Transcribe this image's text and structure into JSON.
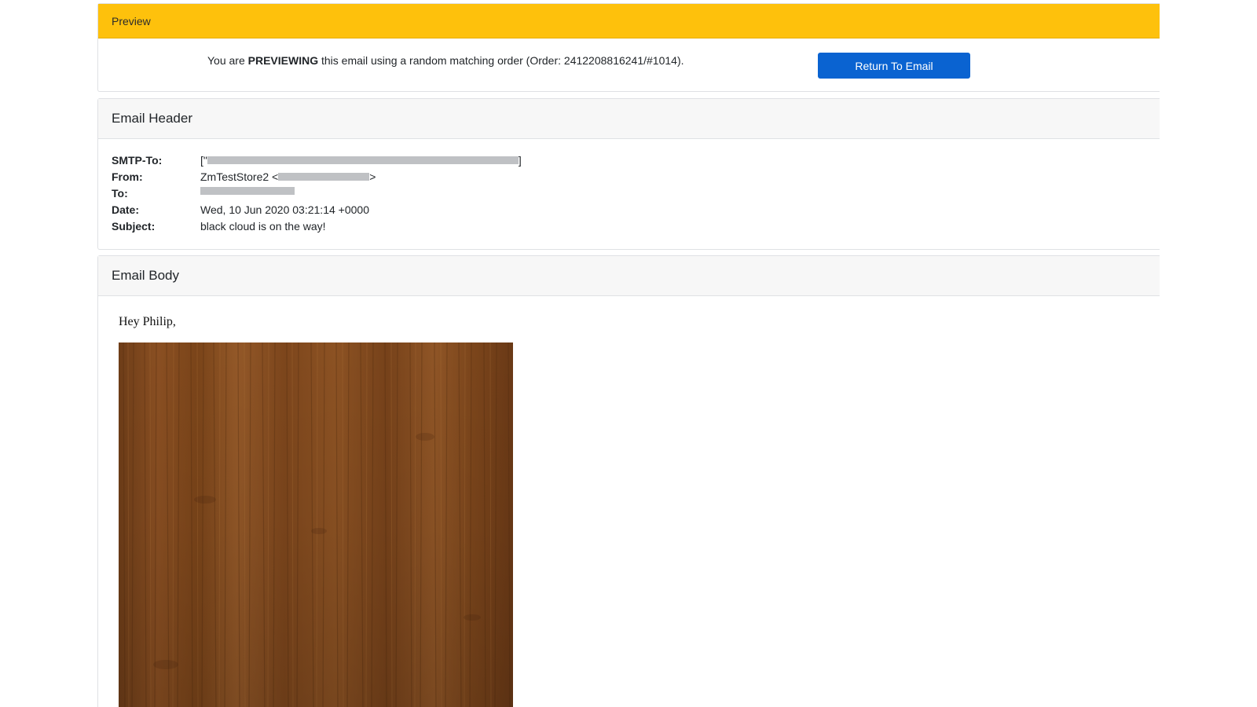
{
  "preview": {
    "label": "Preview",
    "message_prefix": "You are ",
    "message_bold": "PREVIEWING",
    "message_suffix": " this email using a random matching order (Order: 2412208816241/#1014).",
    "return_button": "Return To Email"
  },
  "email_header": {
    "title": "Email Header",
    "fields": {
      "smtp_to_label": "SMTP-To:",
      "smtp_to_prefix": "[\"",
      "smtp_to_suffix": "]",
      "from_label": "From:",
      "from_prefix": "ZmTestStore2 <",
      "from_suffix": ">",
      "to_label": "To:",
      "date_label": "Date:",
      "date_value": "Wed, 10 Jun 2020 03:21:14 +0000",
      "subject_label": "Subject:",
      "subject_value": "black cloud is on the way!"
    }
  },
  "email_body": {
    "title": "Email Body",
    "greeting": "Hey Philip,",
    "image": "wood-texture-product-image"
  },
  "colors": {
    "preview_bar": "#fec10c",
    "button": "#0a63d1",
    "section_header_bg": "#f7f7f7"
  }
}
